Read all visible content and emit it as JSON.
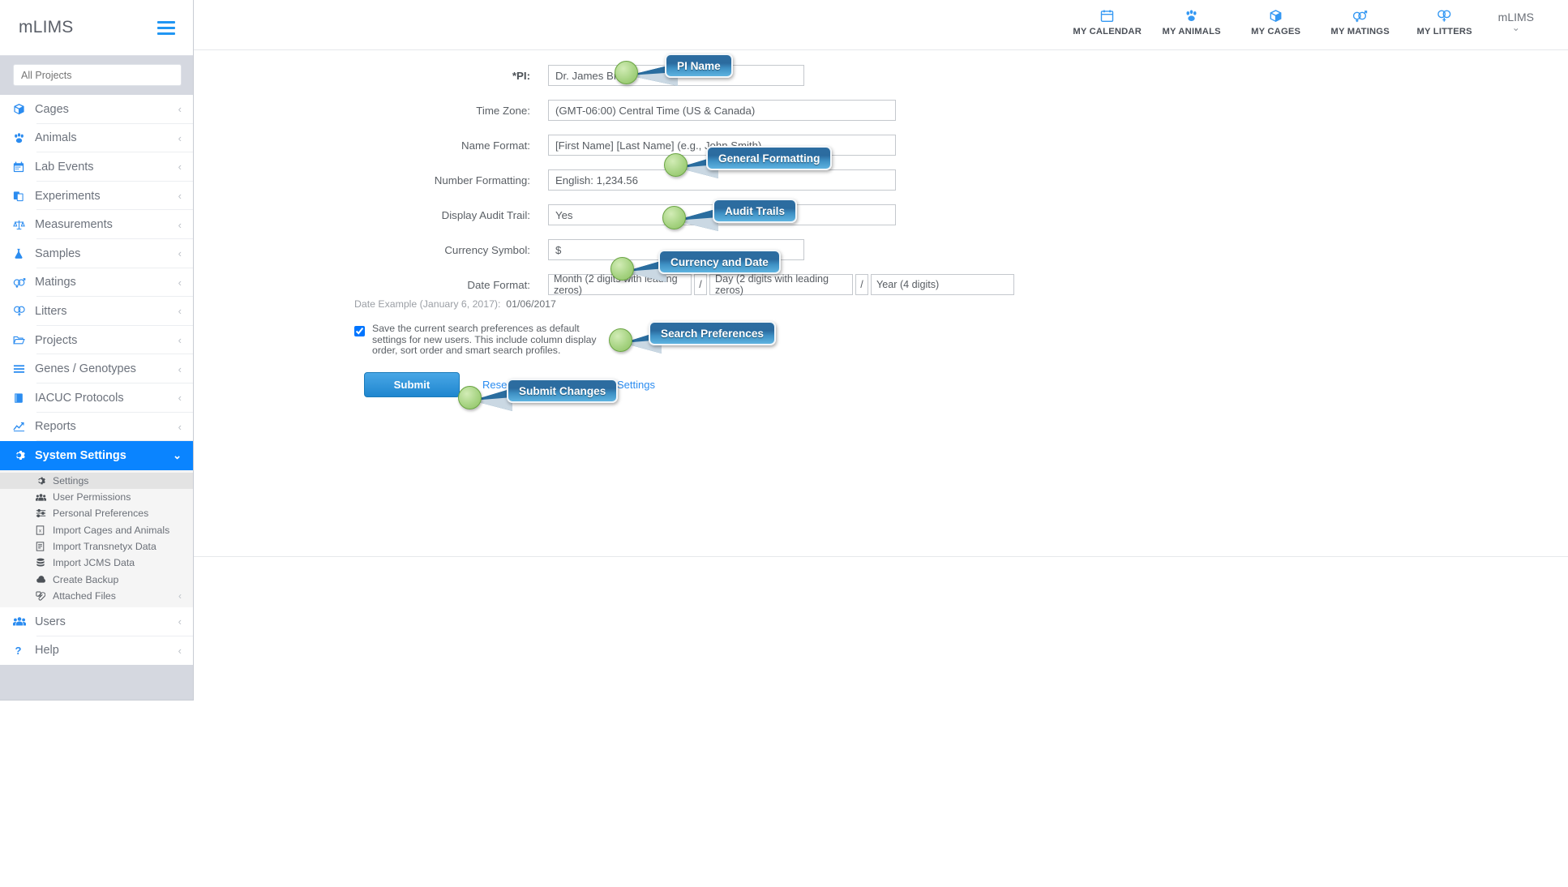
{
  "sidebar": {
    "brand": "mLIMS",
    "hamburger_icon": "hamburger-icon",
    "project_selector": {
      "placeholder": "All Projects",
      "value": ""
    },
    "items": [
      {
        "label": "Cages",
        "icon": "box-icon",
        "chevron": "‹"
      },
      {
        "label": "Animals",
        "icon": "paw-icon",
        "chevron": "‹"
      },
      {
        "label": "Lab Events",
        "icon": "calendar-icon",
        "chevron": "‹"
      },
      {
        "label": "Experiments",
        "icon": "documents-icon",
        "chevron": "‹"
      },
      {
        "label": "Measurements",
        "icon": "scale-icon",
        "chevron": "‹"
      },
      {
        "label": "Samples",
        "icon": "flask-icon",
        "chevron": "‹"
      },
      {
        "label": "Matings",
        "icon": "mating-icon",
        "chevron": "‹"
      },
      {
        "label": "Litters",
        "icon": "litter-icon",
        "chevron": "‹"
      },
      {
        "label": "Projects",
        "icon": "folder-icon",
        "chevron": "‹"
      },
      {
        "label": "Genes / Genotypes",
        "icon": "list-icon",
        "chevron": "‹"
      },
      {
        "label": "IACUC Protocols",
        "icon": "book-icon",
        "chevron": "‹"
      },
      {
        "label": "Reports",
        "icon": "chart-icon",
        "chevron": "‹"
      }
    ],
    "active_item": {
      "label": "System Settings",
      "icon": "gear-icon",
      "chevron": "⌄"
    },
    "subitems": [
      {
        "label": "Settings",
        "icon": "gear-icon",
        "selected": true,
        "chevron": ""
      },
      {
        "label": "User Permissions",
        "icon": "users-icon",
        "selected": false,
        "chevron": ""
      },
      {
        "label": "Personal Preferences",
        "icon": "sliders-icon",
        "selected": false,
        "chevron": ""
      },
      {
        "label": "Import Cages and Animals",
        "icon": "excel-file-icon",
        "selected": false,
        "chevron": ""
      },
      {
        "label": "Import Transnetyx Data",
        "icon": "file-icon",
        "selected": false,
        "chevron": ""
      },
      {
        "label": "Import JCMS Data",
        "icon": "database-icon",
        "selected": false,
        "chevron": ""
      },
      {
        "label": "Create Backup",
        "icon": "cloud-icon",
        "selected": false,
        "chevron": ""
      },
      {
        "label": "Attached Files",
        "icon": "paperclip-icon",
        "selected": false,
        "chevron": "‹"
      }
    ],
    "footer_items": [
      {
        "label": "Users",
        "icon": "users-icon",
        "chevron": "‹"
      },
      {
        "label": "Help",
        "icon": "question-icon",
        "chevron": "‹"
      }
    ]
  },
  "topbar": {
    "nav": [
      {
        "label": "MY CALENDAR",
        "icon": "calendar-icon"
      },
      {
        "label": "MY ANIMALS",
        "icon": "paw-icon"
      },
      {
        "label": "MY CAGES",
        "icon": "box-icon"
      },
      {
        "label": "MY MATINGS",
        "icon": "mating-icon"
      },
      {
        "label": "MY LITTERS",
        "icon": "litter-icon"
      }
    ],
    "user": {
      "name": "mLIMS",
      "caret": "⌄"
    }
  },
  "form": {
    "pi": {
      "label": "*PI:",
      "value": "Dr. James Brown"
    },
    "timezone": {
      "label": "Time Zone:",
      "value": "(GMT-06:00) Central Time (US & Canada)"
    },
    "name_format": {
      "label": "Name Format:",
      "value": "[First Name] [Last Name] (e.g., John Smith)"
    },
    "number_formatting": {
      "label": "Number Formatting:",
      "value": "English: 1,234.56"
    },
    "audit_trail": {
      "label": "Display Audit Trail:",
      "value": "Yes"
    },
    "currency": {
      "label": "Currency Symbol:",
      "value": "$"
    },
    "date_format": {
      "label": "Date Format:",
      "month": "Month (2 digits with leading zeros)",
      "day": "Day (2 digits with leading zeros)",
      "year": "Year (4 digits)",
      "slash": "/"
    },
    "date_example": {
      "prefix": "Date Example (January 6, 2017):",
      "value": "01/06/2017"
    },
    "search_pref_checkbox": {
      "checked": true,
      "text": "Save the current search preferences as default settings for new users. This include column display order, sort order and smart search profiles."
    },
    "submit_label": "Submit",
    "reset_label": "Reset",
    "return_link": "Return to System Settings"
  },
  "callouts": [
    {
      "label": "PI Name"
    },
    {
      "label": "General Formatting"
    },
    {
      "label": "Audit Trails"
    },
    {
      "label": "Currency and Date"
    },
    {
      "label": "Search Preferences"
    },
    {
      "label": "Submit Changes"
    }
  ],
  "colors": {
    "accent_blue": "#0a84ff",
    "icon_blue": "#2b8cf0",
    "sidebar_bg": "#d5d8e0",
    "callout_green": "#a8d484",
    "callout_blue": "#2d6da0"
  }
}
